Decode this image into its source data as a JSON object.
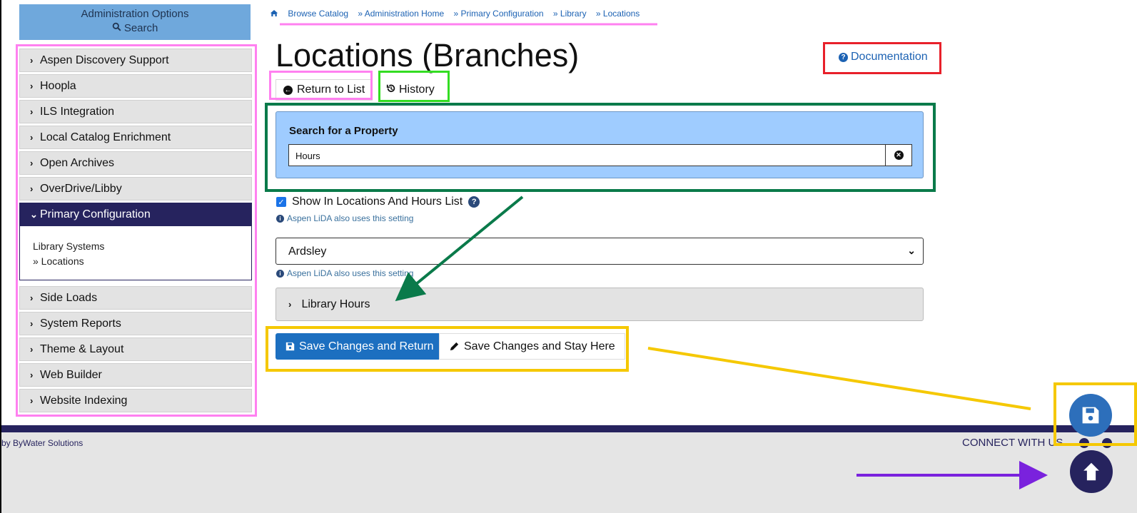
{
  "sidebar": {
    "header_title": "Administration Options",
    "header_search": "Search",
    "items": [
      {
        "label": "Aspen Discovery Support"
      },
      {
        "label": "Hoopla"
      },
      {
        "label": "ILS Integration"
      },
      {
        "label": "Local Catalog Enrichment"
      },
      {
        "label": "Open Archives"
      },
      {
        "label": "OverDrive/Libby"
      },
      {
        "label": "Primary Configuration",
        "expanded": true,
        "sub_items": [
          "Library Systems",
          "» Locations"
        ]
      },
      {
        "label": "Side Loads"
      },
      {
        "label": "System Reports"
      },
      {
        "label": "Theme & Layout"
      },
      {
        "label": "Web Builder"
      },
      {
        "label": "Website Indexing"
      }
    ]
  },
  "breadcrumb": [
    "Browse Catalog",
    "» Administration Home",
    "» Primary Configuration",
    "» Library",
    "» Locations"
  ],
  "main": {
    "title": "Locations (Branches)",
    "documentation_link": "Documentation",
    "return_button": "Return to List",
    "history_button": "History",
    "search_label": "Search for a Property",
    "search_value": "Hours",
    "checkbox_label": "Show In Locations And Hours List",
    "checkbox_checked": true,
    "lida_note": "Aspen LiDA also uses this setting",
    "select_value": "Ardsley",
    "accordion_label": "Library Hours",
    "save_return_button": "Save Changes and Return",
    "save_stay_button": "Save Changes and Stay Here"
  },
  "footer": {
    "credit": "by ByWater Solutions",
    "connect": "CONNECT WITH US"
  },
  "colors": {
    "nav_dark": "#26235e",
    "accent_blue": "#1c6fc0",
    "search_panel": "#9fccff",
    "annotation_pink": "#ff80f0",
    "annotation_red": "#e8202a",
    "annotation_light_green": "#33dd22",
    "annotation_dark_green": "#0a7a4a",
    "annotation_yellow": "#f5c800",
    "annotation_purple": "#7a22dd"
  },
  "icons": [
    "home-icon",
    "search-icon",
    "chevron-right-icon",
    "chevron-down-icon",
    "question-icon",
    "back-arrow-icon",
    "history-icon",
    "clear-icon",
    "info-icon",
    "save-icon",
    "pencil-icon",
    "arrow-up-icon"
  ]
}
